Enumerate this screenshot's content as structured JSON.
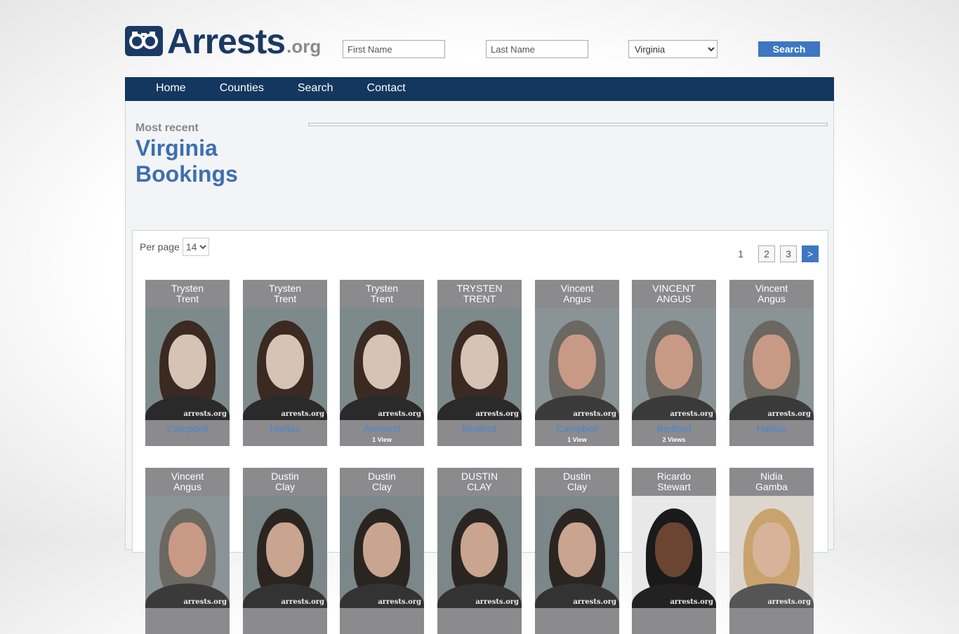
{
  "header": {
    "logo_text": "Arrests",
    "logo_tld": ".org",
    "first_name_placeholder": "First Name",
    "last_name_placeholder": "Last Name",
    "state_selected": "Virginia",
    "search_label": "Search"
  },
  "nav": [
    "Home",
    "Counties",
    "Search",
    "Contact"
  ],
  "intro": {
    "subtitle": "Most recent",
    "title": "Virginia Bookings"
  },
  "controls": {
    "per_page_label": "Per page",
    "per_page_value": "14",
    "pagination": {
      "current": "1",
      "pages": [
        "2",
        "3"
      ],
      "next": ">"
    }
  },
  "watermark": "arrests.org",
  "cards": [
    {
      "first": "Trysten",
      "last": "Trent",
      "county": "Campbell",
      "views": ""
    },
    {
      "first": "Trysten",
      "last": "Trent",
      "county": "Halifax",
      "views": ""
    },
    {
      "first": "Trysten",
      "last": "Trent",
      "county": "Amherst",
      "views": "1 View"
    },
    {
      "first": "TRYSTEN",
      "last": "TRENT",
      "county": "Bedford",
      "views": ""
    },
    {
      "first": "Vincent",
      "last": "Angus",
      "county": "Campbell",
      "views": "1 View"
    },
    {
      "first": "VINCENT",
      "last": "ANGUS",
      "county": "Bedford",
      "views": "2 Views"
    },
    {
      "first": "Vincent",
      "last": "Angus",
      "county": "Halifax",
      "views": ""
    },
    {
      "first": "Vincent",
      "last": "Angus",
      "county": "",
      "views": ""
    },
    {
      "first": "Dustin",
      "last": "Clay",
      "county": "",
      "views": ""
    },
    {
      "first": "Dustin",
      "last": "Clay",
      "county": "",
      "views": ""
    },
    {
      "first": "DUSTIN",
      "last": "CLAY",
      "county": "",
      "views": ""
    },
    {
      "first": "Dustin",
      "last": "Clay",
      "county": "",
      "views": ""
    },
    {
      "first": "Ricardo",
      "last": "Stewart",
      "county": "",
      "views": ""
    },
    {
      "first": "Nidia",
      "last": "Gamba",
      "county": "",
      "views": ""
    }
  ]
}
